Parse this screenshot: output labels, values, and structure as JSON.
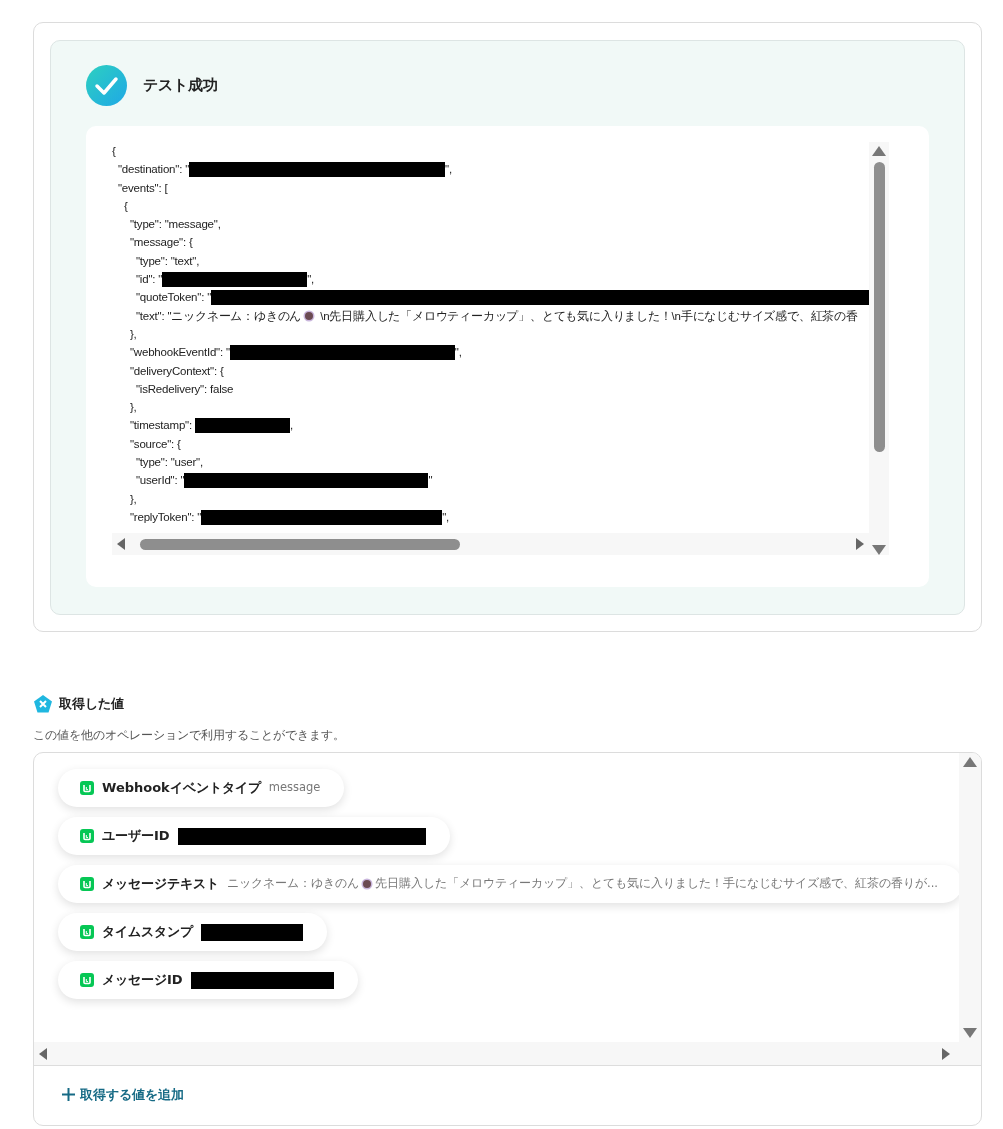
{
  "result": {
    "title": "テスト成功"
  },
  "code_lines": [
    {
      "pre": "{"
    },
    {
      "pre": "  \"destination\": \"",
      "redacted": true,
      "post": "\","
    },
    {
      "pre": "  \"events\": ["
    },
    {
      "pre": "    {"
    },
    {
      "pre": "      \"type\": \"message\","
    },
    {
      "pre": "      \"message\": {"
    },
    {
      "pre": "        \"type\": \"text\","
    },
    {
      "pre": "        \"id\": \"",
      "redacted": true,
      "post": "\","
    },
    {
      "pre": "        \"quoteToken\": \"",
      "redacted": true
    },
    {
      "pre": "        \"text\": \"ニックネーム：ゆきのん",
      "emoji": true,
      "post": " \\n先日購入した「メロウティーカップ」、とても気に入りました！\\n手になじむサイズ感で、紅茶の香"
    },
    {
      "pre": "      },"
    },
    {
      "pre": "      \"webhookEventId\": \"",
      "redacted": true,
      "post": "\","
    },
    {
      "pre": "      \"deliveryContext\": {"
    },
    {
      "pre": "        \"isRedelivery\": false"
    },
    {
      "pre": "      },"
    },
    {
      "pre": "      \"timestamp\": ",
      "redacted": true,
      "post": ","
    },
    {
      "pre": "      \"source\": {"
    },
    {
      "pre": "        \"type\": \"user\","
    },
    {
      "pre": "        \"userId\": \"",
      "redacted": true,
      "post": "\""
    },
    {
      "pre": "      },"
    },
    {
      "pre": "      \"replyToken\": \"",
      "redacted": true,
      "post": "\","
    }
  ],
  "values_section": {
    "title": "取得した値",
    "description": "この値を他のオペレーションで利用することができます。",
    "items": [
      {
        "label": "Webhookイベントタイプ",
        "value": "message"
      },
      {
        "label": "ユーザーID",
        "redacted": true
      },
      {
        "label": "メッセージテキスト",
        "value": "ニックネーム：ゆきのん",
        "emoji": true,
        "value_after": " 先日購入した「メロウティーカップ」、とても気に入りました！手になじむサイズ感で、紅茶の香りが..."
      },
      {
        "label": "タイムスタンプ",
        "redacted": true
      },
      {
        "label": "メッセージID",
        "redacted": true
      }
    ],
    "add_button": "取得する値を追加"
  }
}
